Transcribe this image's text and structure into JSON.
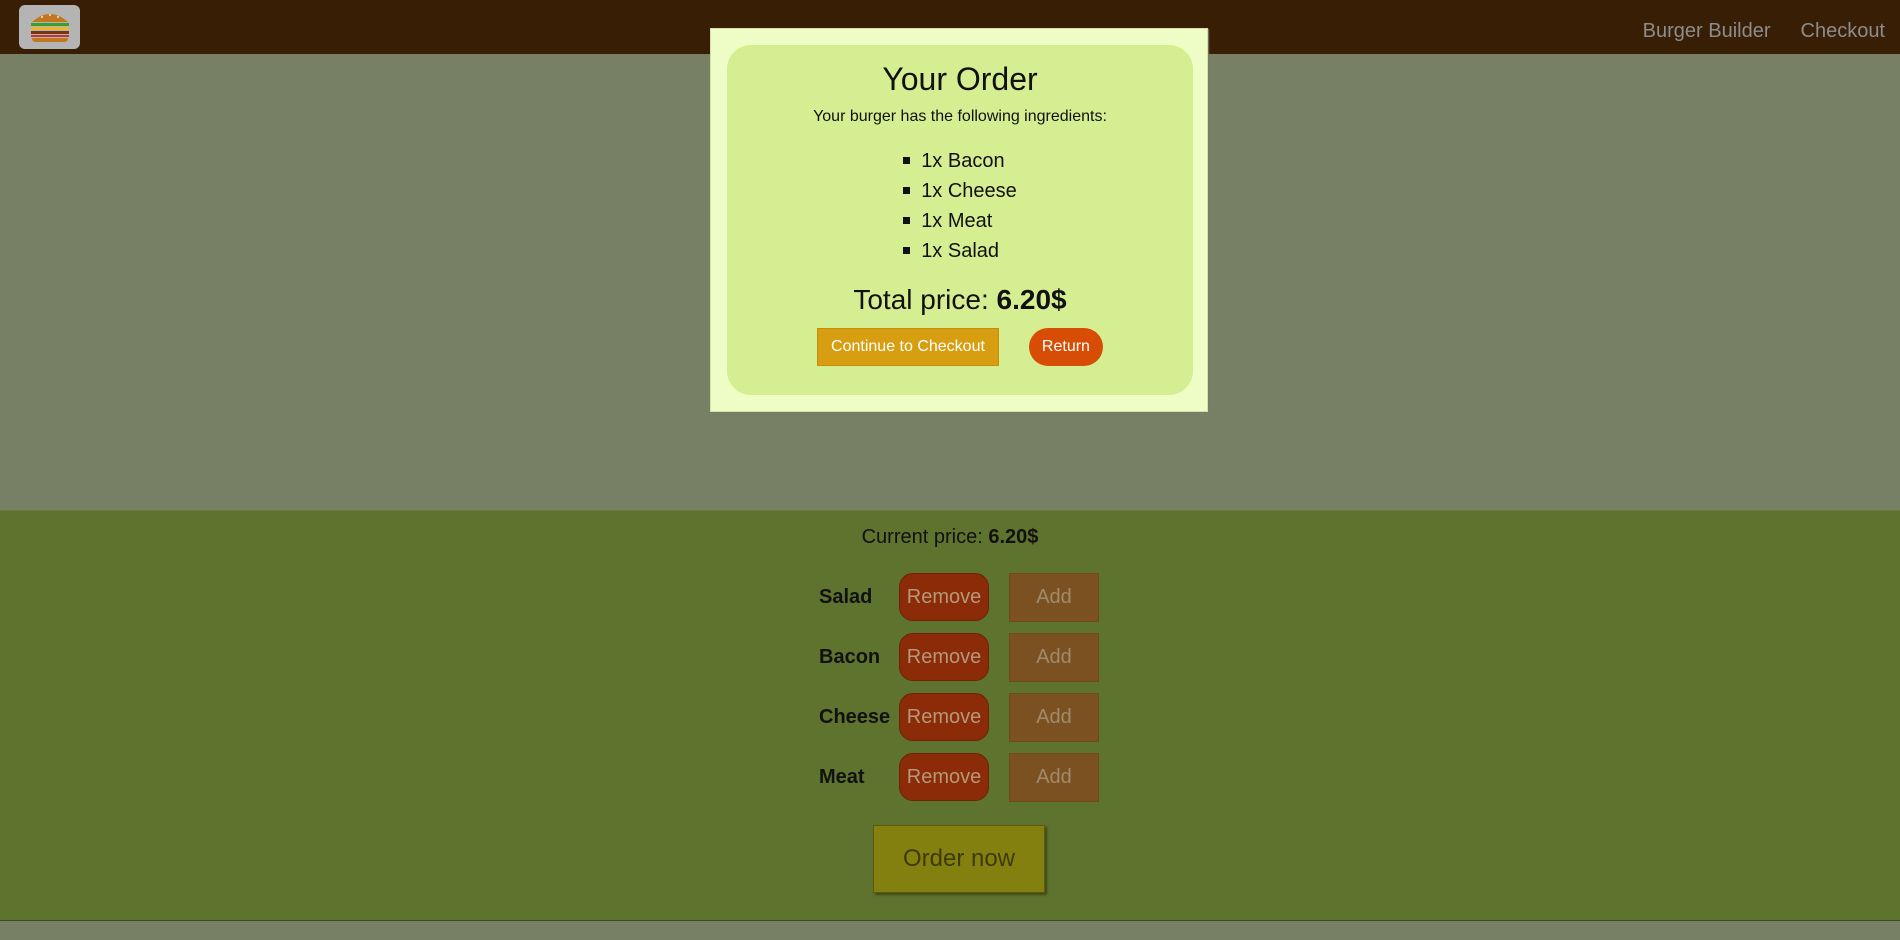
{
  "toolbar": {
    "logo_icon": "burger-icon",
    "nav": [
      {
        "label": "Burger Builder"
      },
      {
        "label": "Checkout"
      }
    ]
  },
  "modal": {
    "title": "Your Order",
    "description": "Your burger has the following ingredients:",
    "ingredients": [
      {
        "label": "1x Bacon"
      },
      {
        "label": "1x Cheese"
      },
      {
        "label": "1x Meat"
      },
      {
        "label": "1x Salad"
      }
    ],
    "total_label": "Total price:",
    "total_value": "6.20$",
    "continue_label": "Continue to Checkout",
    "return_label": "Return"
  },
  "controls": {
    "current_price_label": "Current price:",
    "current_price_value": "6.20$",
    "rows": [
      {
        "label": "Salad",
        "remove": "Remove",
        "add": "Add"
      },
      {
        "label": "Bacon",
        "remove": "Remove",
        "add": "Add"
      },
      {
        "label": "Cheese",
        "remove": "Remove",
        "add": "Add"
      },
      {
        "label": "Meat",
        "remove": "Remove",
        "add": "Add"
      }
    ],
    "order_label": "Order now"
  },
  "colors": {
    "toolbar": "#381e05",
    "backdrop": "#778064",
    "controls_bg": "#5e732e",
    "modal_bg": "#eefdc5",
    "summary_bg": "#d5ee91",
    "continue": "#d89e12",
    "return": "#d74d05"
  }
}
